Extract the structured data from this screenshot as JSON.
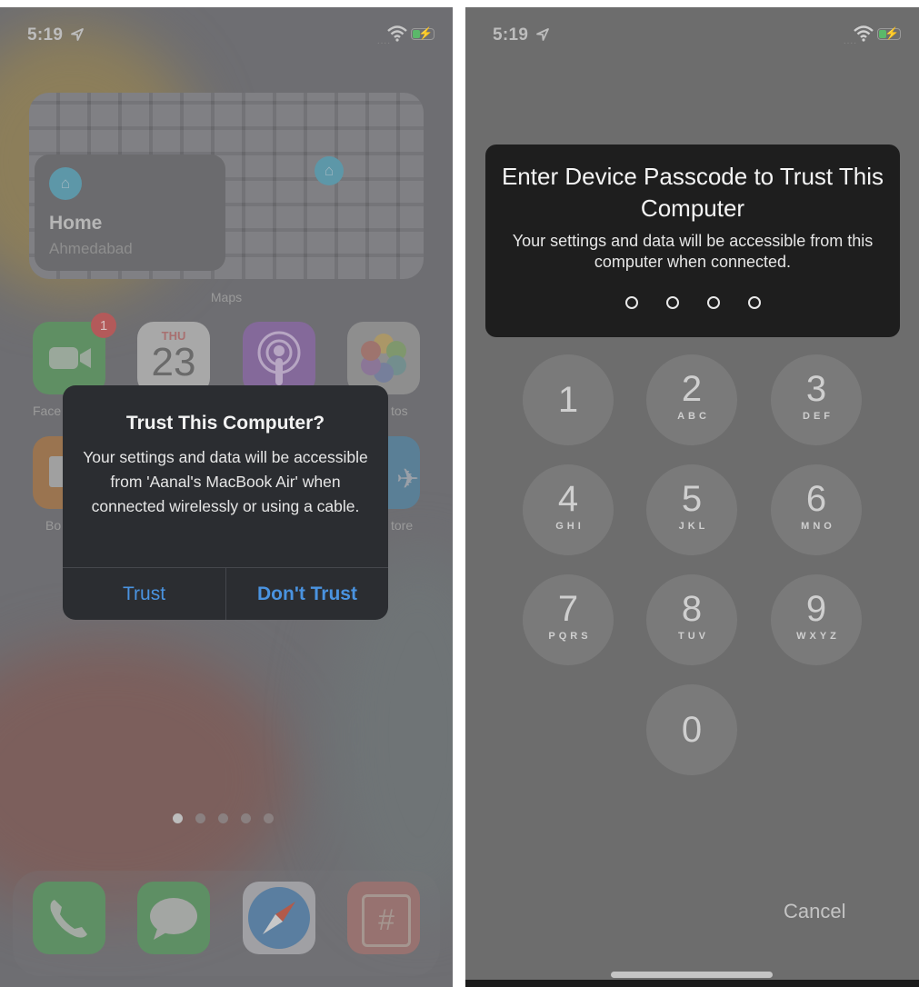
{
  "left_screen": {
    "status_bar": {
      "time": "5:19",
      "location_icon": "location-arrow-icon",
      "signal_icon": "signal-dots-icon",
      "wifi_icon": "wifi-icon",
      "battery_icon": "battery-charging-icon"
    },
    "maps_widget": {
      "place_title": "Home",
      "place_subtitle": "Ahmedabad",
      "widget_label": "Maps",
      "pin_icon": "house-icon"
    },
    "apps_row1": [
      {
        "name": "FaceTime",
        "label": "Face",
        "badge": "1"
      },
      {
        "name": "Calendar",
        "day": "THU",
        "date": "23"
      },
      {
        "name": "Podcasts"
      },
      {
        "name": "Photos",
        "label": "tos"
      }
    ],
    "apps_row2": [
      {
        "name": "Books",
        "label": "Bo"
      },
      {
        "name": "App Store",
        "label": "tore"
      }
    ],
    "page_dots": {
      "count": 5,
      "active_index": 0
    },
    "dock": [
      {
        "name": "Phone",
        "icon": "phone-icon"
      },
      {
        "name": "Messages",
        "icon": "message-bubble-icon"
      },
      {
        "name": "Safari",
        "icon": "compass-icon"
      },
      {
        "name": "Slack-like #",
        "icon": "hashtag-icon"
      }
    ],
    "alert": {
      "title": "Trust This Computer?",
      "message": "Your settings and data will be accessible from 'Aanal's MacBook Air' when connected wirelessly or using a cable.",
      "buttons": {
        "trust": "Trust",
        "dont_trust": "Don't Trust"
      }
    }
  },
  "right_screen": {
    "status_bar": {
      "time": "5:19",
      "location_icon": "location-arrow-icon",
      "wifi_icon": "wifi-icon",
      "battery_icon": "battery-charging-icon"
    },
    "passcode_panel": {
      "title": "Enter Device Passcode to Trust This Computer",
      "message": "Your settings and data will be accessible from this computer when connected.",
      "entered_digits": 0,
      "total_digits": 4
    },
    "keypad": [
      {
        "digit": "1",
        "letters": ""
      },
      {
        "digit": "2",
        "letters": "ABC"
      },
      {
        "digit": "3",
        "letters": "DEF"
      },
      {
        "digit": "4",
        "letters": "GHI"
      },
      {
        "digit": "5",
        "letters": "JKL"
      },
      {
        "digit": "6",
        "letters": "MNO"
      },
      {
        "digit": "7",
        "letters": "PQRS"
      },
      {
        "digit": "8",
        "letters": "TUV"
      },
      {
        "digit": "9",
        "letters": "WXYZ"
      },
      {
        "digit": "0",
        "letters": ""
      }
    ],
    "cancel_label": "Cancel"
  },
  "colors": {
    "accent_blue": "#4a93e0",
    "alert_bg": "#2b2d31",
    "panel_bg": "#1e1e1e",
    "badge_red": "#b35a5a"
  }
}
